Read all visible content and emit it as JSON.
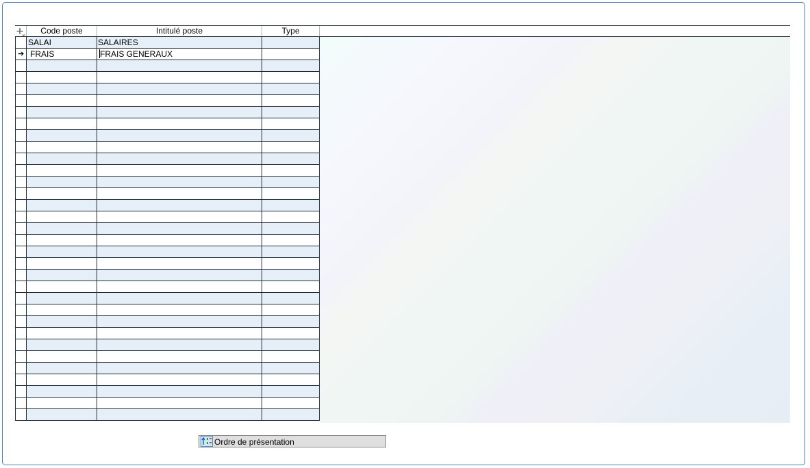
{
  "grid": {
    "add_icon": "plus-icon",
    "columns": [
      "Code poste",
      "Intitulé poste",
      "Type"
    ],
    "rows": [
      {
        "marker": "",
        "code": "SALAI",
        "label": "SALAIRES",
        "type": ""
      },
      {
        "marker": "➔",
        "code": "FRAIS",
        "label": "FRAIS GENERAUX",
        "type": ""
      }
    ],
    "empty_row_count": 31
  },
  "footer": {
    "order_button_label": "Ordre de présentation",
    "order_button_icon": "sort-order-icon"
  },
  "colors": {
    "border": "#4a7fb6",
    "alt_row": "#e6eef7",
    "button_bg": "#dfdfdf"
  }
}
